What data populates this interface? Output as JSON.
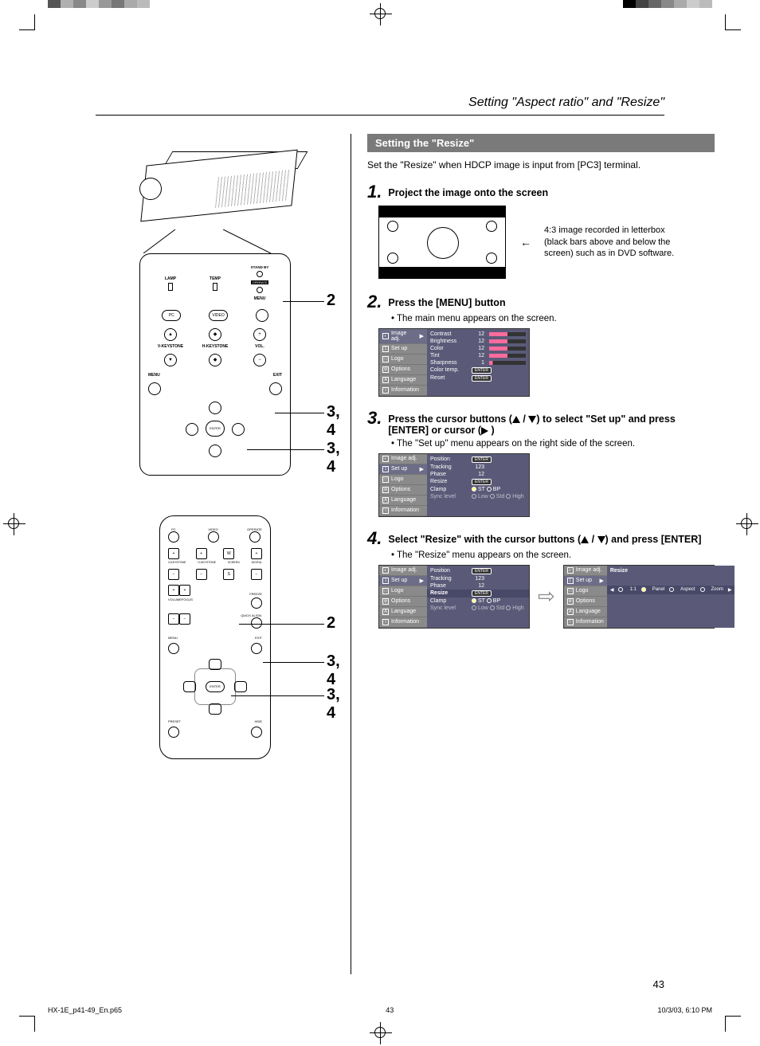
{
  "breadcrumb": "Setting \"Aspect ratio\" and \"Resize\"",
  "section_title": "Setting the \"Resize\"",
  "intro": "Set the \"Resize\" when HDCP image is input from [PC3] terminal.",
  "panel": {
    "standby": "STAND BY",
    "operate": "OPERATE",
    "lamp": "LAMP",
    "temp": "TEMP",
    "menu_lbl": "MENU",
    "pc": "PC",
    "video": "VIDEO",
    "vkey": "V-KEYSTONE",
    "hkey": "H-KEYSTONE",
    "vol": "VOL.",
    "menu2": "MENU",
    "exit": "EXIT",
    "enter": "ENTER"
  },
  "callouts": {
    "c1": "2",
    "c2": "3, 4",
    "c3": "3, 4",
    "r1": "2",
    "r2": "3, 4",
    "r3": "3, 4"
  },
  "remote": {
    "pc": "PC",
    "video": "VIDEO",
    "operate": "OPERATE",
    "vkey": "V-KEYSTONE",
    "hkey": "H-KEYSTONE",
    "screen": "SCREEN\nW/H",
    "digizoom": "DIGITAL\nZOOM",
    "volume": "VOLUME",
    "focus": "FOCUS",
    "freeze": "FREEZE",
    "quick": "QUICK ALIGN.",
    "menu": "MENU",
    "exit": "EXIT",
    "enter": "ENTER",
    "preset": "PRESET",
    "hide": "HIDE"
  },
  "steps": {
    "s1": {
      "num": "1.",
      "title": "Project the image onto the screen"
    },
    "s2": {
      "num": "2.",
      "title": "Press the [MENU] button",
      "bullet": "The main menu appears on the screen."
    },
    "s3": {
      "num": "3.",
      "title_a": "Press the cursor buttons (",
      "title_b": " / ",
      "title_c": ") to select \"Set up\" and press [ENTER] or cursor (",
      "title_d": " )",
      "bullet": "The \"Set up\" menu appears on the right side of the screen."
    },
    "s4": {
      "num": "4.",
      "title_a": "Select \"Resize\" with the cursor buttons  (",
      "title_b": " / ",
      "title_c": ") and press [ENTER]",
      "bullet": "The \"Resize\" menu appears on the screen."
    }
  },
  "letterbox_note": "4:3 image recorded in letterbox (black bars above and below the screen) such as in DVD software.",
  "osd_menu": {
    "items": [
      "Image adj.",
      "Set up",
      "Logo",
      "Options",
      "Language",
      "Information"
    ]
  },
  "osd_image": {
    "rows": [
      {
        "k": "Contrast",
        "v": "12"
      },
      {
        "k": "Brightness",
        "v": "12"
      },
      {
        "k": "Color",
        "v": "12"
      },
      {
        "k": "Tint",
        "v": "12"
      },
      {
        "k": "Sharpness",
        "v": "1"
      }
    ],
    "ctemp": "Color temp.",
    "reset": "Reset",
    "enter": "ENTER"
  },
  "osd_setup": {
    "position": "Position",
    "tracking": "Tracking",
    "tracking_v": "123",
    "phase": "Phase",
    "phase_v": "12",
    "resize": "Resize",
    "clamp": "Clamp",
    "st": "ST",
    "bp": "BP",
    "sync": "Sync level",
    "low": "Low",
    "std": "Std",
    "high": "High",
    "enter": "ENTER"
  },
  "osd_resize": {
    "title": "Resize",
    "one": "1:1",
    "panel": "Panel",
    "aspect": "Aspect",
    "zoom": "Zoom"
  },
  "page_number": "43",
  "footer": {
    "file": "HX-1E_p41-49_En.p65",
    "pg": "43",
    "stamp": "10/3/03, 6:10 PM"
  }
}
